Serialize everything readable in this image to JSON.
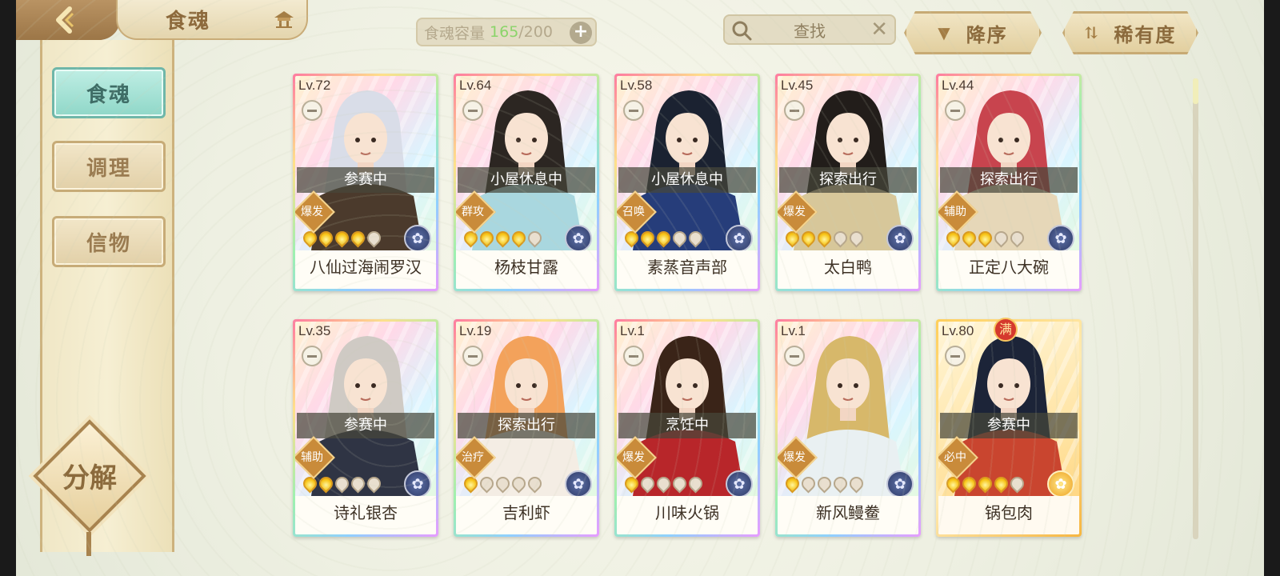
{
  "header": {
    "title": "食魂",
    "capacity_label": "食魂容量",
    "capacity_current": "165",
    "capacity_max": "/200",
    "search_label": "查找",
    "sort_desc_label": "降序",
    "sort_rarity_label": "稀有度"
  },
  "sidebar": {
    "items": [
      {
        "label": "食魂",
        "active": true
      },
      {
        "label": "调理",
        "active": false
      },
      {
        "label": "信物",
        "active": false
      }
    ],
    "decompose_label": "分解"
  },
  "colors": {
    "accent_gold": "#8b6a3c",
    "active_tab": "#8fd7c8",
    "capacity_highlight": "#8bd46a"
  },
  "cards": [
    {
      "level": "Lv.72",
      "status": "参赛中",
      "role": "爆发",
      "stars_filled": 4,
      "name": "八仙过海闹罗汉",
      "hair": "#d9dde8",
      "outfit": "#4b3a2c",
      "element": "blue-flower"
    },
    {
      "level": "Lv.64",
      "status": "小屋休息中",
      "role": "群攻",
      "stars_filled": 4,
      "name": "杨枝甘露",
      "hair": "#2c2622",
      "outfit": "#a9d7df",
      "element": "blue-flower"
    },
    {
      "level": "Lv.58",
      "status": "小屋休息中",
      "role": "召唤",
      "stars_filled": 3,
      "name": "素蒸音声部",
      "hair": "#1b2231",
      "outfit": "#263d7a",
      "element": "blue-flower"
    },
    {
      "level": "Lv.45",
      "status": "探索出行",
      "role": "爆发",
      "stars_filled": 3,
      "name": "太白鸭",
      "hair": "#221d1a",
      "outfit": "#d7c79a",
      "element": "blue-flower"
    },
    {
      "level": "Lv.44",
      "status": "探索出行",
      "role": "辅助",
      "stars_filled": 3,
      "name": "正定八大碗",
      "hair": "#c8444e",
      "outfit": "#e6d7b8",
      "element": "blue-flower"
    },
    {
      "level": "Lv.35",
      "status": "参赛中",
      "role": "辅助",
      "stars_filled": 2,
      "name": "诗礼银杏",
      "hair": "#cfcac4",
      "outfit": "#2f3444",
      "element": "blue-flower"
    },
    {
      "level": "Lv.19",
      "status": "探索出行",
      "role": "治疗",
      "stars_filled": 1,
      "name": "吉利虾",
      "hair": "#f3a25b",
      "outfit": "#f4ede4",
      "element": "blue-flower"
    },
    {
      "level": "Lv.1",
      "status": "烹饪中",
      "role": "爆发",
      "stars_filled": 1,
      "name": "川味火锅",
      "hair": "#3a2418",
      "outfit": "#b8262a",
      "element": "blue-flower"
    },
    {
      "level": "Lv.1",
      "status": "",
      "role": "爆发",
      "stars_filled": 1,
      "name": "新风鳗鲞",
      "hair": "#d7b86a",
      "outfit": "#e9f0f2",
      "element": "blue-flower"
    },
    {
      "level": "Lv.80",
      "status": "参赛中",
      "role": "必中",
      "stars_filled": 4,
      "name": "锅包肉",
      "hair": "#1c2438",
      "outfit": "#c9452f",
      "element": "sun-flower",
      "max_badge": "满",
      "gold": true
    }
  ]
}
